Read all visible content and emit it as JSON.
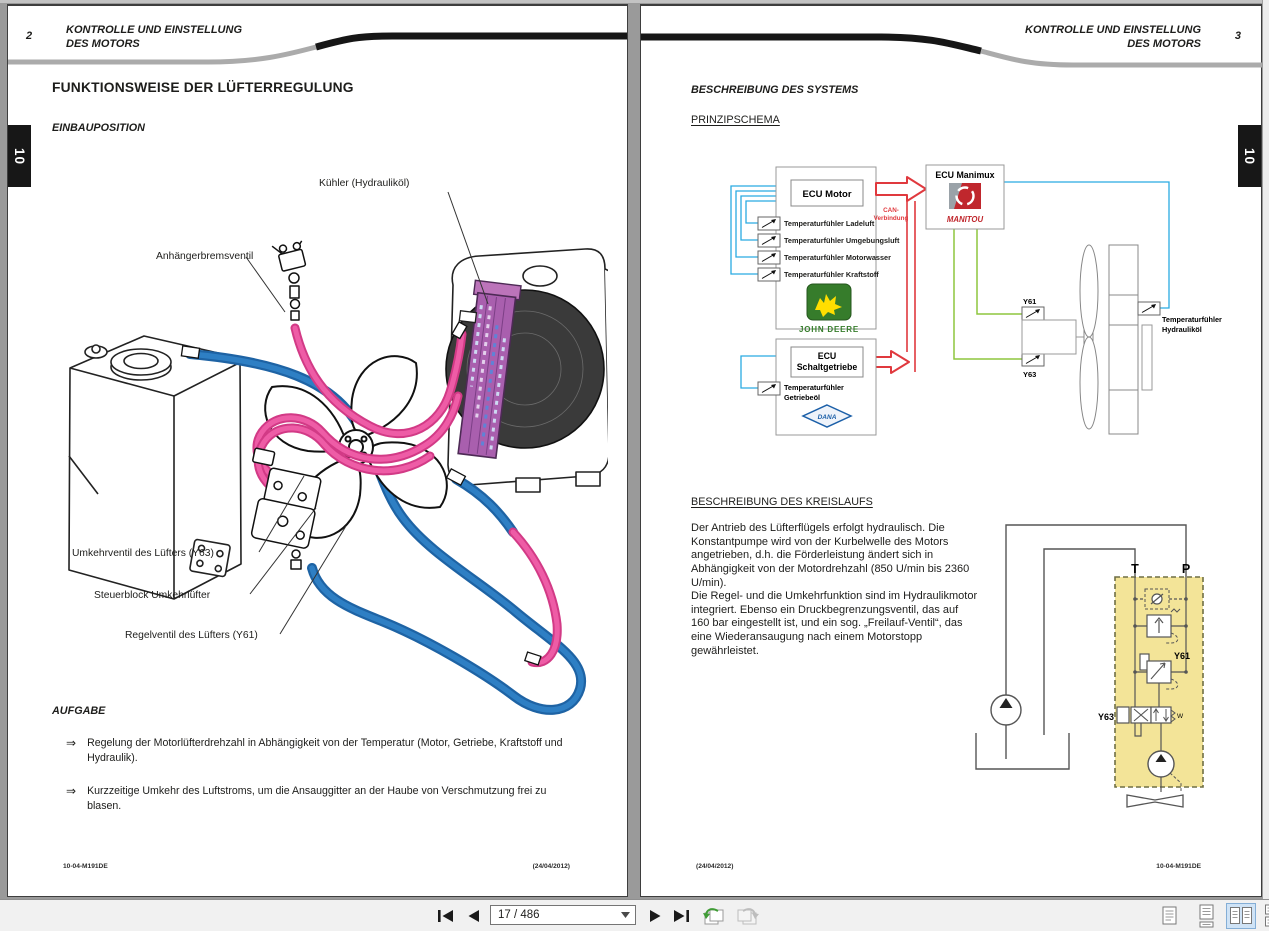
{
  "colors": {
    "hose_blue": "#2273b8",
    "hose_pink": "#ec4f9e",
    "cooler_purple": "#a95fae",
    "line_cyan": "#29abe2",
    "line_red": "#e0393e",
    "line_green": "#8dc63f",
    "schematic_yellow": "#f3e498",
    "selected_view_bg": "#cfe3f6"
  },
  "left_page": {
    "page_number": "2",
    "header": {
      "line1": "KONTROLLE UND EINSTELLUNG",
      "line2": "DES MOTORS"
    },
    "tab": "10",
    "title": "FUNKTIONSWEISE DER LÜFTERREGULUNG",
    "section_einbau": "EINBAUPOSITION",
    "illustration_labels": {
      "kuehler": "Kühler (Hydrauliköl)",
      "anhaengerbremsventil": "Anhängerbremsventil",
      "umkehrventil": "Umkehrventil des Lüfters (Y63)",
      "steuerblock": "Steuerblock Umkehrlüfter",
      "regelventil": "Regelventil des Lüfters (Y61)"
    },
    "aufgabe": {
      "heading": "AUFGABE",
      "bullet_glyph": "⇒",
      "items": [
        "Regelung der Motorlüfterdrehzahl in Abhängigkeit von der Temperatur (Motor, Getriebe, Kraftstoff und Hydraulik).",
        "Kurzzeitige Umkehr des Luftstroms, um die Ansauggitter an der Haube von Verschmutzung frei zu blasen."
      ]
    },
    "footer": {
      "left": "10-04-M191DE",
      "right": "(24/04/2012)"
    }
  },
  "right_page": {
    "page_number": "3",
    "header": {
      "line1": "KONTROLLE UND EINSTELLUNG",
      "line2": "DES MOTORS"
    },
    "tab": "10",
    "section_system": "BESCHREIBUNG DES SYSTEMS",
    "section_prinzip": "PRINZIPSCHEMA",
    "schema": {
      "ecu_motor": "ECU Motor",
      "sensors": [
        "Temperaturfühler Ladeluft",
        "Temperaturfühler Umgebungsluft",
        "Temperaturfühler Motorwasser",
        "Temperaturfühler Kraftstoff"
      ],
      "john_deere": "JOHN DEERE",
      "can_line1": "CAN-",
      "can_line2": "Verbindung",
      "ecu_manimux": "ECU Manimux",
      "manitou": "MANITOU",
      "ecu_getriebe_line1": "ECU",
      "ecu_getriebe_line2": "Schaltgetriebe",
      "getriebe_sensor_line1": "Temperaturfühler",
      "getriebe_sensor_line2": "Getriebeöl",
      "dana": "DANA",
      "y61": "Y61",
      "y63": "Y63",
      "hydr_sensor_line1": "Temperaturfühler",
      "hydr_sensor_line2": "Hydrauliköl"
    },
    "section_kreislauf": "BESCHREIBUNG DES KREISLAUFS",
    "paragraph1": "Der Antrieb des Lüfterflügels erfolgt hydraulisch. Die Konstantpumpe wird von der Kurbelwelle des Motors angetrieben, d.h. die Förderleistung ändert sich in Abhängigkeit von der Motordrehzahl (850 U/min bis 2360 U/min).",
    "paragraph2": "Die Regel- und die Umkehrfunktion sind im Hydraulikmotor integriert. Ebenso ein Druckbegrenzungsventil, das auf 160 bar eingestellt ist, und ein sog. „Freilauf-Ventil“, das eine Wiederansaugung nach einem Motorstopp gewährleistet.",
    "hydraulic": {
      "t": "T",
      "p": "P",
      "y61": "Y61",
      "y63": "Y63",
      "w": "W"
    },
    "footer": {
      "left": "(24/04/2012)",
      "right": "10-04-M191DE"
    }
  },
  "toolbar": {
    "page_field_value": "17 / 486",
    "selected_view": "two-page-view",
    "icons": [
      "first-page",
      "previous-page",
      "next-page",
      "last-page",
      "previous-view",
      "next-view",
      "single-page-view",
      "continuous-view",
      "two-page-view",
      "two-page-continuous-view"
    ]
  }
}
